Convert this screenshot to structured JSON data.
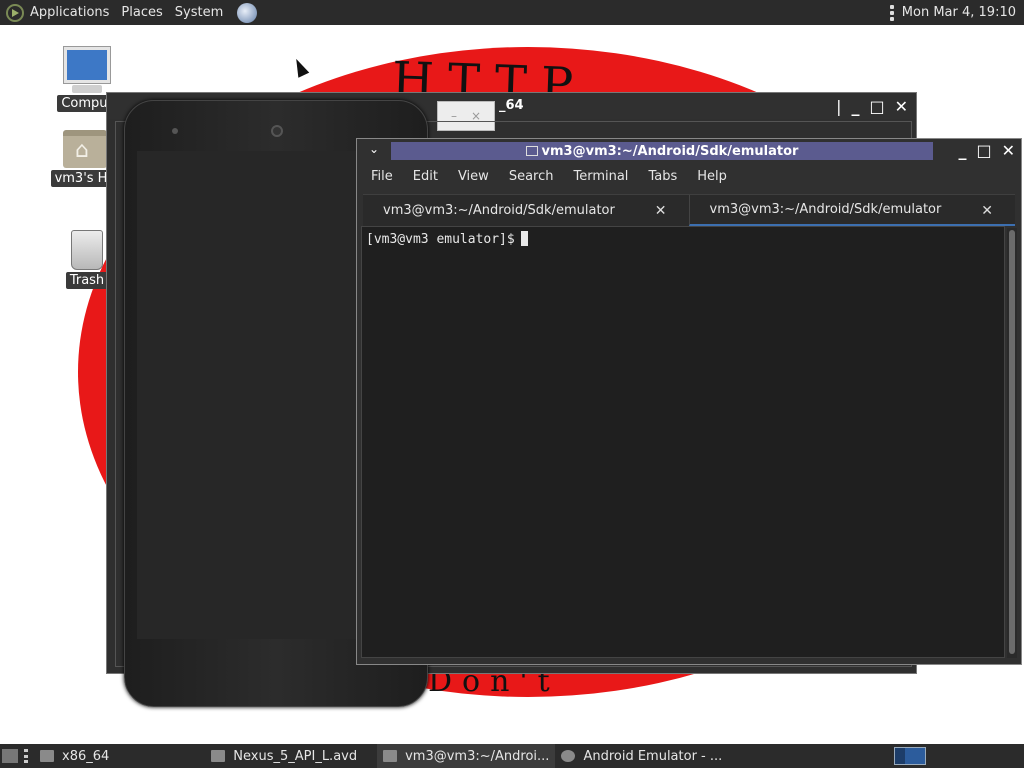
{
  "top_panel": {
    "applications": "Applications",
    "places": "Places",
    "system": "System",
    "clock": "Mon Mar  4, 19:10"
  },
  "desktop": {
    "icons": [
      {
        "label": "Comput",
        "icon": "computer-icon"
      },
      {
        "label": "vm3's Ho",
        "icon": "home-folder-icon"
      },
      {
        "label": "Trash",
        "icon": "trash-icon"
      }
    ]
  },
  "emulator_window": {
    "title": "_64"
  },
  "terminal": {
    "title": "vm3@vm3:~/Android/Sdk/emulator",
    "menu": [
      "File",
      "Edit",
      "View",
      "Search",
      "Terminal",
      "Tabs",
      "Help"
    ],
    "tabs": [
      {
        "label": "vm3@vm3:~/Android/Sdk/emulator",
        "active": false
      },
      {
        "label": "vm3@vm3:~/Android/Sdk/emulator",
        "active": true
      }
    ],
    "prompt": "[vm3@vm3 emulator]$"
  },
  "taskbar": {
    "items": [
      {
        "label": "x86_64",
        "icon": "folder-icon"
      },
      {
        "label": "Nexus_5_API_L.avd",
        "icon": "folder-icon"
      },
      {
        "label": "vm3@vm3:~/Androi...",
        "icon": "terminal-icon"
      },
      {
        "label": "Android Emulator - ...",
        "icon": "emulator-icon"
      }
    ]
  },
  "colors": {
    "panel_bg": "#2b2b2b",
    "wallpaper_red": "#e81818",
    "terminal_title_accent": "#5b5b8f",
    "active_tab_underline": "#3c6fb0"
  }
}
